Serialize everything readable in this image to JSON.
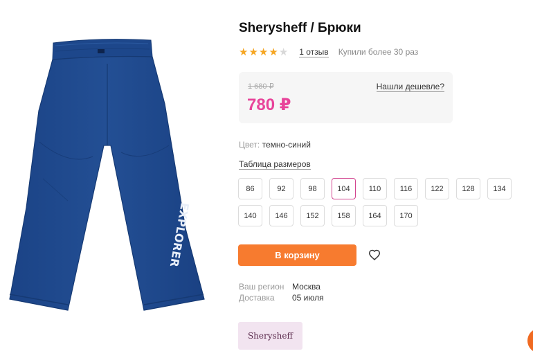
{
  "product": {
    "title": "Sherysheff / Брюки",
    "rating": 4,
    "rating_max": 5,
    "reviews_link": "1 отзыв",
    "bought_text": "Купили более 30 раз",
    "image_print": "EXPLORER"
  },
  "price": {
    "old": "1 680 ₽",
    "current": "780 ₽",
    "cheaper_link": "Нашли дешевле?"
  },
  "color": {
    "label": "Цвет:",
    "value": "темно-синий"
  },
  "size_table_link": "Таблица размеров",
  "sizes": [
    "86",
    "92",
    "98",
    "104",
    "110",
    "116",
    "122",
    "128",
    "134",
    "140",
    "146",
    "152",
    "158",
    "164",
    "170"
  ],
  "selected_size": "104",
  "cart_button": "В корзину",
  "delivery": {
    "region_label": "Ваш регион",
    "region_value": "Москва",
    "delivery_label": "Доставка",
    "delivery_value": "05 июля"
  },
  "brand": "Sherysheff",
  "colors": {
    "accent_price": "#e8439a",
    "cart_button": "#f77b2f",
    "star": "#f5a623",
    "pants": "#1f4a8c",
    "brand_badge_bg": "#f2e4f0"
  },
  "icons": [
    "star-icon",
    "heart-icon"
  ]
}
